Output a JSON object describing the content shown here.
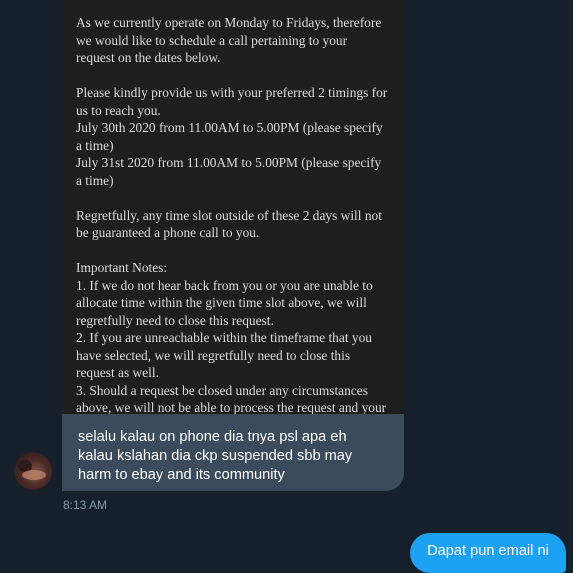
{
  "conversation": {
    "incoming": {
      "email_image_lines": [
        "As we currently operate on Monday to Fridays, therefore",
        "we would like to schedule a call pertaining to your",
        "request on the dates below.",
        "",
        "Please kindly provide us with your preferred 2 timings for",
        "us to reach you.",
        "July 30th 2020 from 11.00AM to 5.00PM (please specify",
        "a time)",
        "July 31st 2020 from 11.00AM to 5.00PM (please specify",
        "a time)",
        "",
        "Regretfully, any time slot outside of these 2 days will not",
        "be guaranteed a phone call to you.",
        "",
        "Important Notes:",
        "1. If we do not hear back from you or you are unable to",
        "allocate time within the given time slot above, we will",
        "regretfully need to close this request.",
        "2. If you are unreachable within the timeframe that you",
        "have selected, we will regretfully need to close this",
        "request as well.",
        "3. Should a request be closed under any circumstances",
        "above, we will not be able to process the request and your"
      ],
      "message_lines": [
        "selalu kalau on phone dia tnya psl apa eh",
        "kalau kslahan dia ckp suspended sbb may",
        "harm to ebay and its community"
      ],
      "timestamp": "8:13 AM"
    },
    "outgoing": {
      "message": "Dapat pun email ni"
    }
  },
  "colors": {
    "background": "#15202b",
    "incoming_bubble": "#3b4b5b",
    "outgoing_bubble": "#1da1f2",
    "email_background": "#1e1e1e",
    "timestamp_text": "#8899a6"
  }
}
